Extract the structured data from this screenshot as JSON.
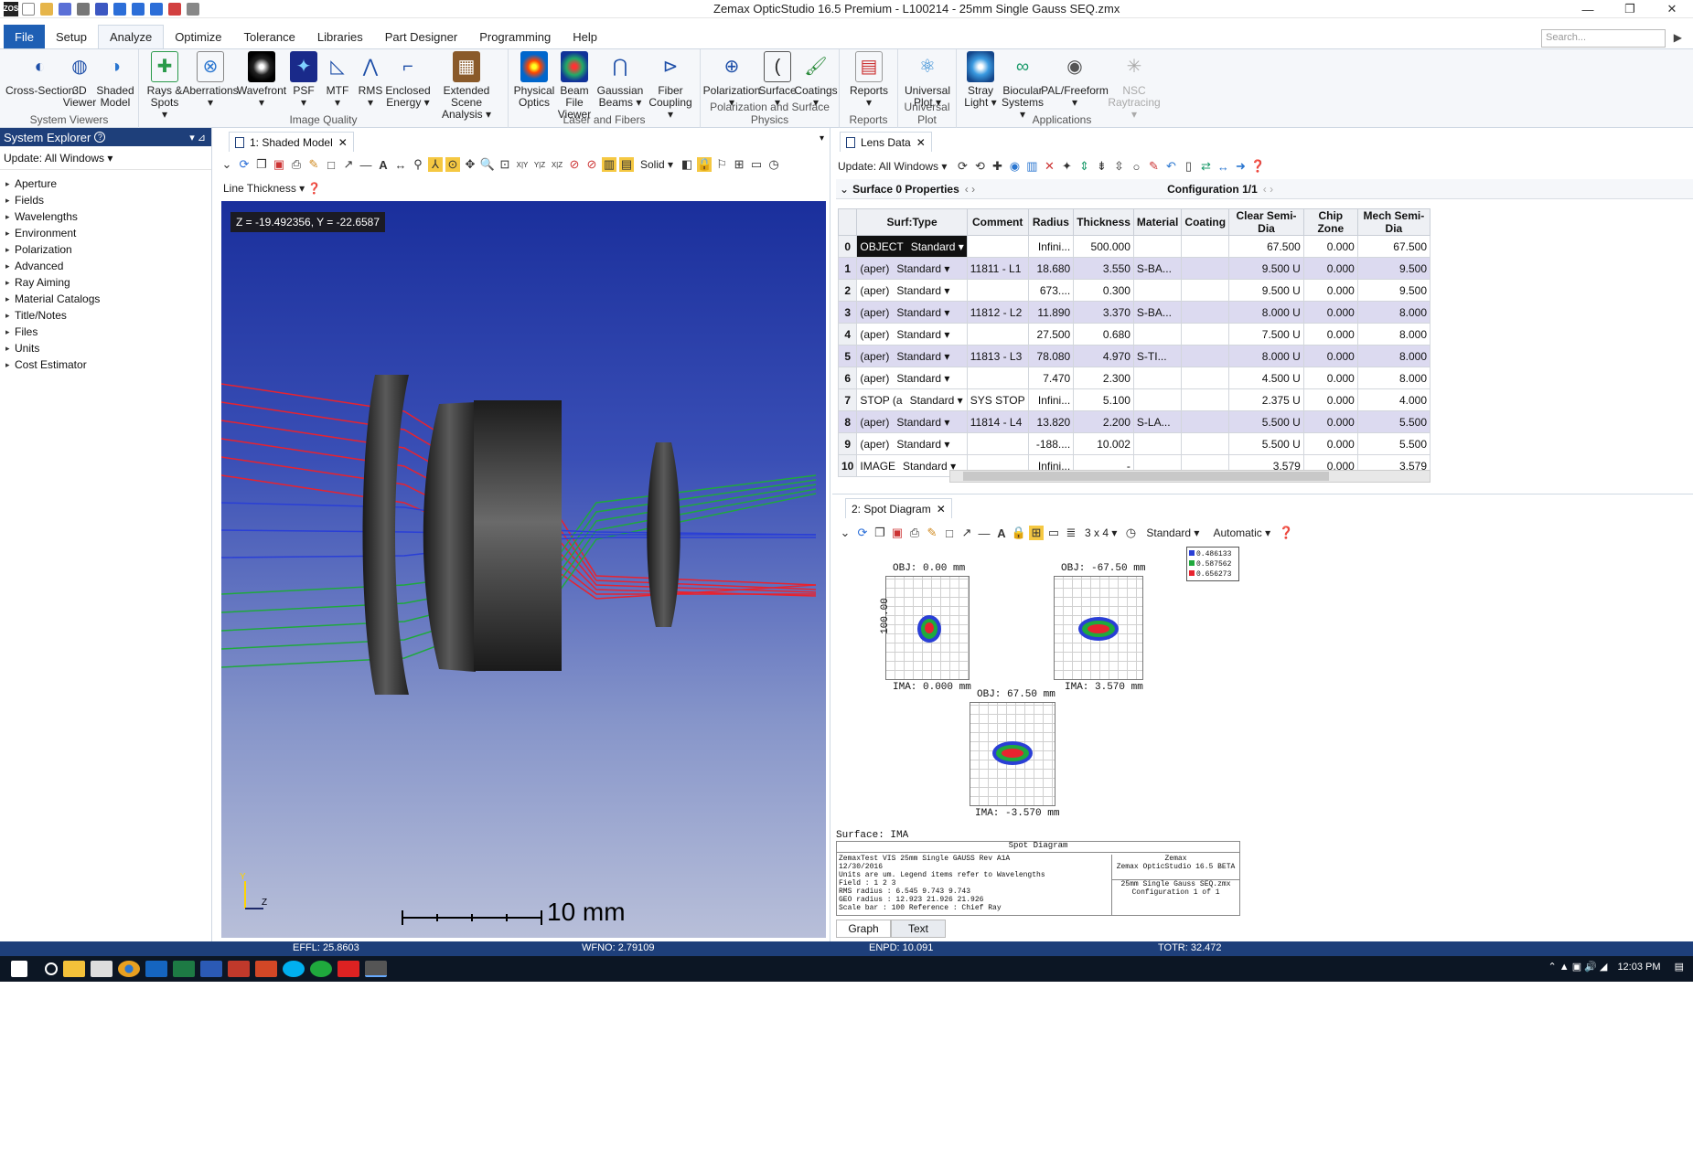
{
  "window": {
    "app_icon": "ZOS",
    "title": "Zemax OpticStudio 16.5   Premium - L100214 - 25mm Single Gauss SEQ.zmx",
    "controls": [
      "—",
      "❐",
      "✕"
    ]
  },
  "ribbon_tabs": [
    "File",
    "Setup",
    "Analyze",
    "Optimize",
    "Tolerance",
    "Libraries",
    "Part Designer",
    "Programming",
    "Help"
  ],
  "active_tab": "Analyze",
  "search_placeholder": "Search...",
  "ribbon_groups": [
    {
      "label": "System Viewers",
      "buttons": [
        "Cross-Section",
        "3D Viewer",
        "Shaded Model"
      ]
    },
    {
      "label": "Image Quality",
      "buttons": [
        "Rays & Spots ▾",
        "Aberrations ▾",
        "Wavefront ▾",
        "PSF ▾",
        "MTF ▾",
        "RMS ▾",
        "Enclosed Energy ▾",
        "Extended Scene Analysis ▾"
      ]
    },
    {
      "label": "Laser and Fibers",
      "buttons": [
        "Physical Optics",
        "Beam File Viewer",
        "Gaussian Beams ▾",
        "Fiber Coupling ▾"
      ]
    },
    {
      "label": "Polarization and Surface Physics",
      "buttons": [
        "Polarization ▾",
        "Surface ▾",
        "Coatings ▾"
      ]
    },
    {
      "label": "Reports",
      "buttons": [
        "Reports ▾"
      ]
    },
    {
      "label": "Universal Plot",
      "buttons": [
        "Universal Plot ▾"
      ]
    },
    {
      "label": "Applications",
      "buttons": [
        "Stray Light ▾",
        "Biocular Systems ▾",
        "PAL/Freeform ▾",
        "NSC Raytracing ▾"
      ]
    }
  ],
  "system_explorer": {
    "title": "System Explorer",
    "update": "Update: All Windows ▾",
    "items": [
      "Aperture",
      "Fields",
      "Wavelengths",
      "Environment",
      "Polarization",
      "Advanced",
      "Ray Aiming",
      "Material Catalogs",
      "Title/Notes",
      "Files",
      "Units",
      "Cost Estimator"
    ]
  },
  "shaded_model": {
    "tab": "1: Shaded Model",
    "line_thickness": "Line Thickness ▾",
    "solid": "Solid ▾",
    "coord": "Z = -19.492356, Y = -22.6587",
    "scale": "10 mm",
    "axis_y": "Y",
    "axis_z": "Z"
  },
  "lens_data": {
    "tab": "Lens Data",
    "update": "Update: All Windows ▾",
    "surface_props": "Surface 0 Properties",
    "configuration": "Configuration 1/1",
    "headers": [
      "",
      "Surf:Type",
      "Comment",
      "Radius",
      "Thickness",
      "Material",
      "Coating",
      "Clear Semi-Dia",
      "Chip Zone",
      "Mech Semi-Dia"
    ],
    "rows": [
      {
        "i": "0",
        "surf": "OBJECT",
        "type": "Standard ▾",
        "comment": "",
        "radius": "Infini...",
        "thick": "500.000",
        "mat": "",
        "coat": "",
        "clear": "67.500",
        "chip": "0.000",
        "mech": "67.500",
        "hl": false
      },
      {
        "i": "1",
        "surf": "(aper)",
        "type": "Standard ▾",
        "comment": "11811 - L1",
        "radius": "18.680",
        "thick": "3.550",
        "mat": "S-BA...",
        "coat": "",
        "clear": "9.500 U",
        "chip": "0.000",
        "mech": "9.500",
        "hl": true
      },
      {
        "i": "2",
        "surf": "(aper)",
        "type": "Standard ▾",
        "comment": "",
        "radius": "673....",
        "thick": "0.300",
        "mat": "",
        "coat": "",
        "clear": "9.500 U",
        "chip": "0.000",
        "mech": "9.500",
        "hl": false
      },
      {
        "i": "3",
        "surf": "(aper)",
        "type": "Standard ▾",
        "comment": "11812 - L2",
        "radius": "11.890",
        "thick": "3.370",
        "mat": "S-BA...",
        "coat": "",
        "clear": "8.000 U",
        "chip": "0.000",
        "mech": "8.000",
        "hl": true
      },
      {
        "i": "4",
        "surf": "(aper)",
        "type": "Standard ▾",
        "comment": "",
        "radius": "27.500",
        "thick": "0.680",
        "mat": "",
        "coat": "",
        "clear": "7.500 U",
        "chip": "0.000",
        "mech": "8.000",
        "hl": false
      },
      {
        "i": "5",
        "surf": "(aper)",
        "type": "Standard ▾",
        "comment": "11813 - L3",
        "radius": "78.080",
        "thick": "4.970",
        "mat": "S-TI...",
        "coat": "",
        "clear": "8.000 U",
        "chip": "0.000",
        "mech": "8.000",
        "hl": true
      },
      {
        "i": "6",
        "surf": "(aper)",
        "type": "Standard ▾",
        "comment": "",
        "radius": "7.470",
        "thick": "2.300",
        "mat": "",
        "coat": "",
        "clear": "4.500 U",
        "chip": "0.000",
        "mech": "8.000",
        "hl": false
      },
      {
        "i": "7",
        "surf": "STOP (a",
        "type": "Standard ▾",
        "comment": "SYS STOP",
        "radius": "Infini...",
        "thick": "5.100",
        "mat": "",
        "coat": "",
        "clear": "2.375 U",
        "chip": "0.000",
        "mech": "4.000",
        "hl": false
      },
      {
        "i": "8",
        "surf": "(aper)",
        "type": "Standard ▾",
        "comment": "11814 - L4",
        "radius": "13.820",
        "thick": "2.200",
        "mat": "S-LA...",
        "coat": "",
        "clear": "5.500 U",
        "chip": "0.000",
        "mech": "5.500",
        "hl": true
      },
      {
        "i": "9",
        "surf": "(aper)",
        "type": "Standard ▾",
        "comment": "",
        "radius": "-188....",
        "thick": "10.002",
        "mat": "",
        "coat": "",
        "clear": "5.500 U",
        "chip": "0.000",
        "mech": "5.500",
        "hl": false
      },
      {
        "i": "10",
        "surf": "IMAGE",
        "type": "Standard ▾",
        "comment": "",
        "radius": "Infini...",
        "thick": "-",
        "mat": "",
        "coat": "",
        "clear": "3.579",
        "chip": "0.000",
        "mech": "3.579",
        "hl": false
      }
    ]
  },
  "spot_diagram": {
    "tab": "2: Spot Diagram",
    "grid": "3 x 4 ▾",
    "standard": "Standard ▾",
    "automatic": "Automatic ▾",
    "obj1": "OBJ: 0.00 mm",
    "ima1": "IMA: 0.000 mm",
    "obj2": "OBJ: -67.50 mm",
    "ima2": "IMA: 3.570 mm",
    "obj3": "OBJ: 67.50 mm",
    "ima3": "IMA: -3.570 mm",
    "axis_label": "100.00",
    "legend": [
      "0.486133",
      "0.587562",
      "0.656273"
    ],
    "surface": "Surface: IMA",
    "box_title": "Spot Diagram",
    "box_left": [
      "ZemaxTest VIS 25mm Single GAUSS Rev A1A",
      "12/30/2016",
      "Units are um. Legend items refer to Wavelengths",
      "Field       :    1        2        3",
      "RMS radius :   6.545    9.743    9.743",
      "GEO radius :  12.923   21.926   21.926",
      "Scale bar  :  100      Reference  :  Chief Ray"
    ],
    "box_right": [
      "Zemax",
      "Zemax OpticStudio 16.5  BETA",
      "",
      "25mm Single Gauss SEQ.zmx",
      "Configuration 1 of 1"
    ],
    "bottom_tabs": [
      "Graph",
      "Text"
    ]
  },
  "status": {
    "effl": "EFFL: 25.8603",
    "wfno": "WFNO: 2.79109",
    "enpd": "ENPD: 10.091",
    "totr": "TOTR: 32.472"
  },
  "taskbar": {
    "time": "12:03 PM"
  },
  "colors": {
    "file_tab": "#1e5fb4",
    "panel_header": "#1e3f7a",
    "ray_red": "#e8232f",
    "ray_green": "#1fa93d",
    "ray_blue": "#2a3fd6"
  }
}
